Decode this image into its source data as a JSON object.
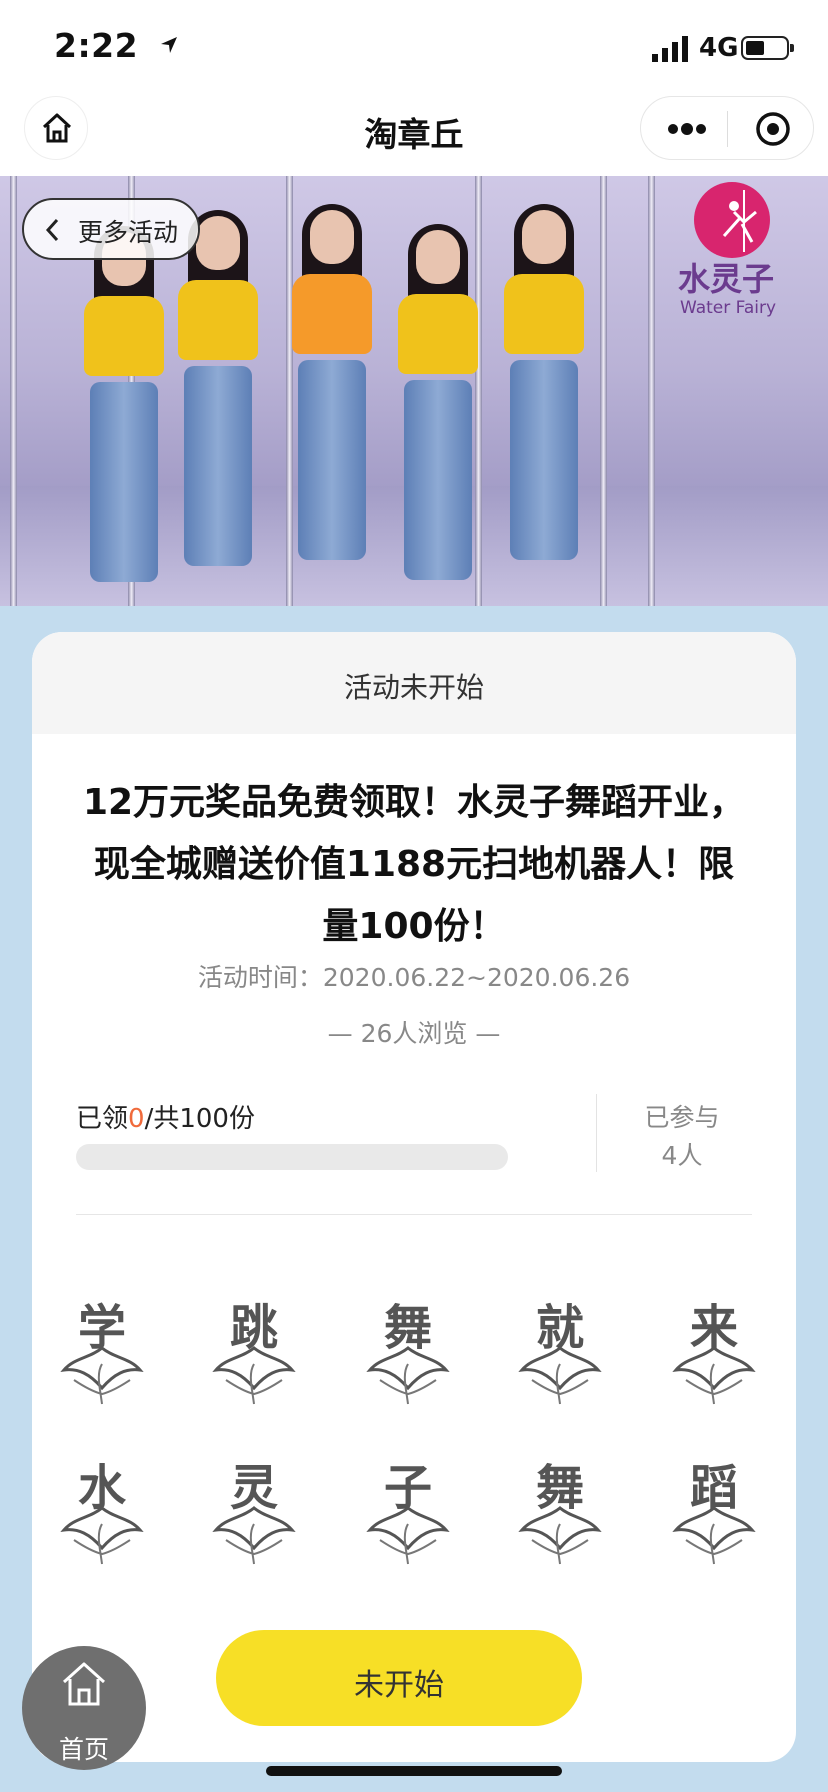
{
  "status_bar": {
    "time": "2:22",
    "network": "4G"
  },
  "nav": {
    "title": "淘章丘"
  },
  "banner": {
    "more_button": "更多活动",
    "brand_cn": "水灵子",
    "brand_en": "Water Fairy"
  },
  "activity": {
    "status": "活动未开始",
    "title": "12万元奖品免费领取！水灵子舞蹈开业，现全城赠送价值1188元扫地机器人！限量100份！",
    "time": "活动时间：2020.06.22~2020.06.26",
    "views": "— 26人浏览 —",
    "claimed_prefix": "已领",
    "claimed_count": "0",
    "claimed_suffix": "/共100份",
    "progress_fraction": 0,
    "joined_label": "已参与",
    "joined_count": "4人",
    "characters": [
      "学",
      "跳",
      "舞",
      "就",
      "来",
      "水",
      "灵",
      "子",
      "舞",
      "蹈"
    ],
    "action_button": "未开始"
  },
  "home_button": {
    "label": "首页"
  },
  "colors": {
    "accent_yellow": "#f7df26",
    "highlight_orange": "#f06a3b",
    "page_bg": "#c3dcee"
  }
}
